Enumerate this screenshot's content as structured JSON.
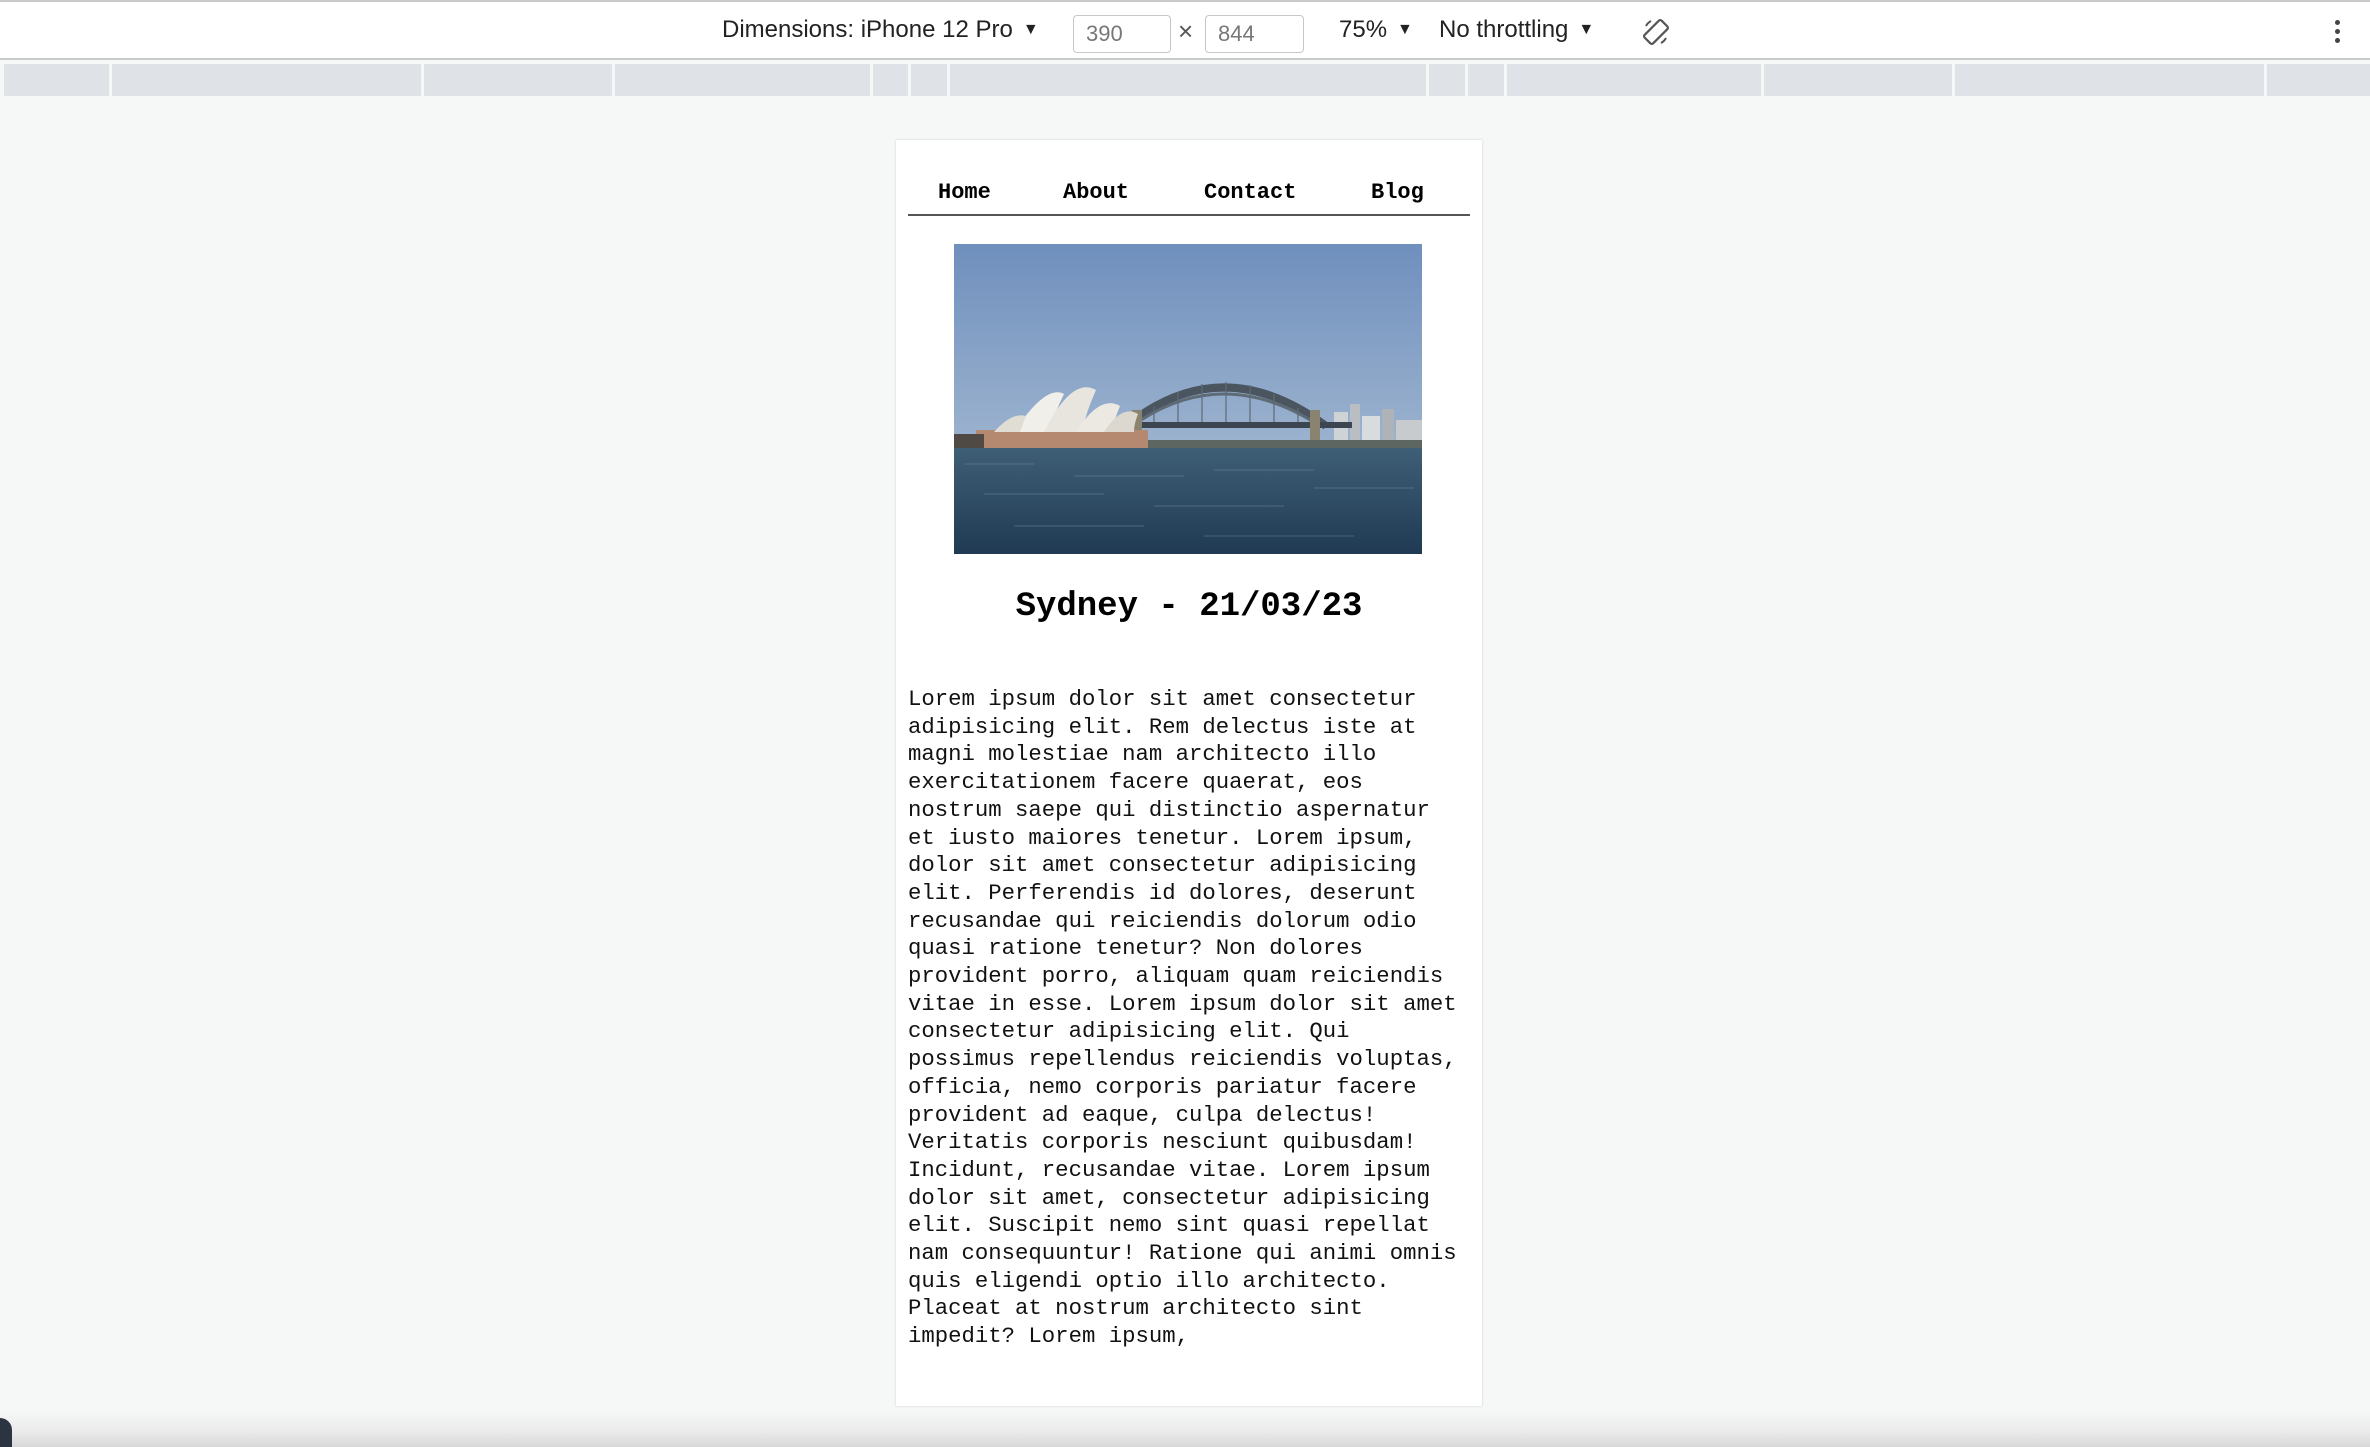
{
  "devtools": {
    "dimensions_label": "Dimensions: iPhone 12 Pro",
    "width_value": "390",
    "height_value": "844",
    "times": "×",
    "zoom": "75%",
    "throttling": "No throttling",
    "caret": "▼"
  },
  "page": {
    "nav": [
      "Home",
      "About",
      "Contact",
      "Blog"
    ],
    "hero_alt": "Sydney Opera House and Harbour Bridge",
    "title": "Sydney - 21/03/23",
    "body": "Lorem ipsum dolor sit amet consectetur adipisicing elit. Rem delectus iste at magni molestiae nam architecto illo exercitationem facere quaerat, eos nostrum saepe qui distinctio aspernatur et iusto maiores tenetur. Lorem ipsum, dolor sit amet consectetur adipisicing elit. Perferendis id dolores, deserunt recusandae qui reiciendis dolorum odio quasi ratione tenetur? Non dolores provident porro, aliquam quam reiciendis vitae in esse. Lorem ipsum dolor sit amet consectetur adipisicing elit. Qui possimus repellendus reiciendis voluptas, officia, nemo corporis pariatur facere provident ad eaque, culpa delectus! Veritatis corporis nesciunt quibusdam! Incidunt, recusandae vitae. Lorem ipsum dolor sit amet, consectetur adipisicing elit. Suscipit nemo sint quasi repellat nam consequuntur! Ratione qui animi omnis quis eligendi optio illo architecto. Placeat at nostrum architecto sint impedit? Lorem ipsum,"
  }
}
